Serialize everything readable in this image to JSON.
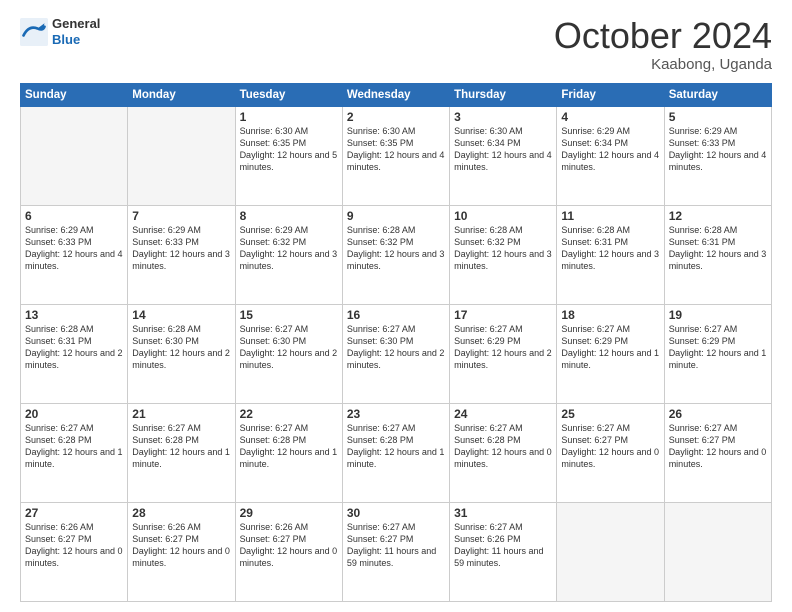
{
  "header": {
    "logo_general": "General",
    "logo_blue": "Blue",
    "month": "October 2024",
    "location": "Kaabong, Uganda"
  },
  "weekdays": [
    "Sunday",
    "Monday",
    "Tuesday",
    "Wednesday",
    "Thursday",
    "Friday",
    "Saturday"
  ],
  "weeks": [
    [
      {
        "day": "",
        "sunrise": "",
        "sunset": "",
        "daylight": ""
      },
      {
        "day": "",
        "sunrise": "",
        "sunset": "",
        "daylight": ""
      },
      {
        "day": "1",
        "sunrise": "Sunrise: 6:30 AM",
        "sunset": "Sunset: 6:35 PM",
        "daylight": "Daylight: 12 hours and 5 minutes."
      },
      {
        "day": "2",
        "sunrise": "Sunrise: 6:30 AM",
        "sunset": "Sunset: 6:35 PM",
        "daylight": "Daylight: 12 hours and 4 minutes."
      },
      {
        "day": "3",
        "sunrise": "Sunrise: 6:30 AM",
        "sunset": "Sunset: 6:34 PM",
        "daylight": "Daylight: 12 hours and 4 minutes."
      },
      {
        "day": "4",
        "sunrise": "Sunrise: 6:29 AM",
        "sunset": "Sunset: 6:34 PM",
        "daylight": "Daylight: 12 hours and 4 minutes."
      },
      {
        "day": "5",
        "sunrise": "Sunrise: 6:29 AM",
        "sunset": "Sunset: 6:33 PM",
        "daylight": "Daylight: 12 hours and 4 minutes."
      }
    ],
    [
      {
        "day": "6",
        "sunrise": "Sunrise: 6:29 AM",
        "sunset": "Sunset: 6:33 PM",
        "daylight": "Daylight: 12 hours and 4 minutes."
      },
      {
        "day": "7",
        "sunrise": "Sunrise: 6:29 AM",
        "sunset": "Sunset: 6:33 PM",
        "daylight": "Daylight: 12 hours and 3 minutes."
      },
      {
        "day": "8",
        "sunrise": "Sunrise: 6:29 AM",
        "sunset": "Sunset: 6:32 PM",
        "daylight": "Daylight: 12 hours and 3 minutes."
      },
      {
        "day": "9",
        "sunrise": "Sunrise: 6:28 AM",
        "sunset": "Sunset: 6:32 PM",
        "daylight": "Daylight: 12 hours and 3 minutes."
      },
      {
        "day": "10",
        "sunrise": "Sunrise: 6:28 AM",
        "sunset": "Sunset: 6:32 PM",
        "daylight": "Daylight: 12 hours and 3 minutes."
      },
      {
        "day": "11",
        "sunrise": "Sunrise: 6:28 AM",
        "sunset": "Sunset: 6:31 PM",
        "daylight": "Daylight: 12 hours and 3 minutes."
      },
      {
        "day": "12",
        "sunrise": "Sunrise: 6:28 AM",
        "sunset": "Sunset: 6:31 PM",
        "daylight": "Daylight: 12 hours and 3 minutes."
      }
    ],
    [
      {
        "day": "13",
        "sunrise": "Sunrise: 6:28 AM",
        "sunset": "Sunset: 6:31 PM",
        "daylight": "Daylight: 12 hours and 2 minutes."
      },
      {
        "day": "14",
        "sunrise": "Sunrise: 6:28 AM",
        "sunset": "Sunset: 6:30 PM",
        "daylight": "Daylight: 12 hours and 2 minutes."
      },
      {
        "day": "15",
        "sunrise": "Sunrise: 6:27 AM",
        "sunset": "Sunset: 6:30 PM",
        "daylight": "Daylight: 12 hours and 2 minutes."
      },
      {
        "day": "16",
        "sunrise": "Sunrise: 6:27 AM",
        "sunset": "Sunset: 6:30 PM",
        "daylight": "Daylight: 12 hours and 2 minutes."
      },
      {
        "day": "17",
        "sunrise": "Sunrise: 6:27 AM",
        "sunset": "Sunset: 6:29 PM",
        "daylight": "Daylight: 12 hours and 2 minutes."
      },
      {
        "day": "18",
        "sunrise": "Sunrise: 6:27 AM",
        "sunset": "Sunset: 6:29 PM",
        "daylight": "Daylight: 12 hours and 1 minute."
      },
      {
        "day": "19",
        "sunrise": "Sunrise: 6:27 AM",
        "sunset": "Sunset: 6:29 PM",
        "daylight": "Daylight: 12 hours and 1 minute."
      }
    ],
    [
      {
        "day": "20",
        "sunrise": "Sunrise: 6:27 AM",
        "sunset": "Sunset: 6:28 PM",
        "daylight": "Daylight: 12 hours and 1 minute."
      },
      {
        "day": "21",
        "sunrise": "Sunrise: 6:27 AM",
        "sunset": "Sunset: 6:28 PM",
        "daylight": "Daylight: 12 hours and 1 minute."
      },
      {
        "day": "22",
        "sunrise": "Sunrise: 6:27 AM",
        "sunset": "Sunset: 6:28 PM",
        "daylight": "Daylight: 12 hours and 1 minute."
      },
      {
        "day": "23",
        "sunrise": "Sunrise: 6:27 AM",
        "sunset": "Sunset: 6:28 PM",
        "daylight": "Daylight: 12 hours and 1 minute."
      },
      {
        "day": "24",
        "sunrise": "Sunrise: 6:27 AM",
        "sunset": "Sunset: 6:28 PM",
        "daylight": "Daylight: 12 hours and 0 minutes."
      },
      {
        "day": "25",
        "sunrise": "Sunrise: 6:27 AM",
        "sunset": "Sunset: 6:27 PM",
        "daylight": "Daylight: 12 hours and 0 minutes."
      },
      {
        "day": "26",
        "sunrise": "Sunrise: 6:27 AM",
        "sunset": "Sunset: 6:27 PM",
        "daylight": "Daylight: 12 hours and 0 minutes."
      }
    ],
    [
      {
        "day": "27",
        "sunrise": "Sunrise: 6:26 AM",
        "sunset": "Sunset: 6:27 PM",
        "daylight": "Daylight: 12 hours and 0 minutes."
      },
      {
        "day": "28",
        "sunrise": "Sunrise: 6:26 AM",
        "sunset": "Sunset: 6:27 PM",
        "daylight": "Daylight: 12 hours and 0 minutes."
      },
      {
        "day": "29",
        "sunrise": "Sunrise: 6:26 AM",
        "sunset": "Sunset: 6:27 PM",
        "daylight": "Daylight: 12 hours and 0 minutes."
      },
      {
        "day": "30",
        "sunrise": "Sunrise: 6:27 AM",
        "sunset": "Sunset: 6:27 PM",
        "daylight": "Daylight: 11 hours and 59 minutes."
      },
      {
        "day": "31",
        "sunrise": "Sunrise: 6:27 AM",
        "sunset": "Sunset: 6:26 PM",
        "daylight": "Daylight: 11 hours and 59 minutes."
      },
      {
        "day": "",
        "sunrise": "",
        "sunset": "",
        "daylight": ""
      },
      {
        "day": "",
        "sunrise": "",
        "sunset": "",
        "daylight": ""
      }
    ]
  ]
}
